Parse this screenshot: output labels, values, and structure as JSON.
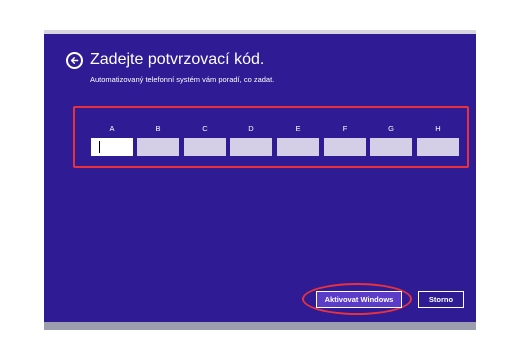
{
  "dialog": {
    "title": "Zadejte potvrzovací kód.",
    "subtitle": "Automatizovaný telefonní systém vám poradí, co zadat."
  },
  "code_fields": [
    {
      "label": "A",
      "value": ""
    },
    {
      "label": "B",
      "value": ""
    },
    {
      "label": "C",
      "value": ""
    },
    {
      "label": "D",
      "value": ""
    },
    {
      "label": "E",
      "value": ""
    },
    {
      "label": "F",
      "value": ""
    },
    {
      "label": "G",
      "value": ""
    },
    {
      "label": "H",
      "value": ""
    }
  ],
  "buttons": {
    "activate_label": "Aktivovat Windows",
    "cancel_label": "Storno"
  },
  "icons": {
    "back": "back-arrow-icon"
  },
  "colors": {
    "background": "#2f1b93",
    "highlight": "#e7323d",
    "field": "#d4cfe6",
    "primary_button": "#5a3cc8"
  }
}
